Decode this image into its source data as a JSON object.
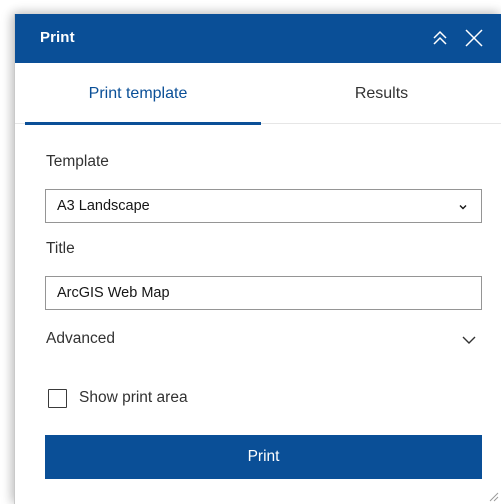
{
  "panel": {
    "title": "Print",
    "icons": {
      "collapse": "double-chevron-up-icon",
      "close": "close-icon"
    }
  },
  "tabs": [
    {
      "label": "Print template",
      "active": true
    },
    {
      "label": "Results",
      "active": false
    }
  ],
  "form": {
    "template_label": "Template",
    "template_value": "A3 Landscape",
    "title_label": "Title",
    "title_value": "ArcGIS Web Map",
    "advanced_label": "Advanced",
    "show_print_area_label": "Show print area",
    "show_print_area_checked": false,
    "print_button_label": "Print"
  },
  "colors": {
    "brand": "#0a4f97",
    "text": "#323232",
    "border": "#959595"
  }
}
